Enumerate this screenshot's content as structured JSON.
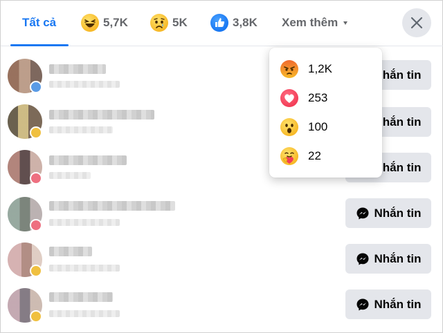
{
  "tabs": {
    "all_label": "Tất cả",
    "haha_count": "5,7K",
    "sad_count": "5K",
    "like_count": "3,8K",
    "more_label": "Xem thêm"
  },
  "dropdown": {
    "items": [
      {
        "icon": "angry-emoji-icon",
        "count": "1,2K"
      },
      {
        "icon": "love-emoji-icon",
        "count": "253"
      },
      {
        "icon": "wow-emoji-icon",
        "count": "100"
      },
      {
        "icon": "care-emoji-icon",
        "count": "22"
      }
    ]
  },
  "list": {
    "message_label": "Nhắn tin"
  },
  "colors": {
    "accent": "#1877f2",
    "button_bg": "#e4e6eb",
    "text_secondary": "#65676b"
  }
}
